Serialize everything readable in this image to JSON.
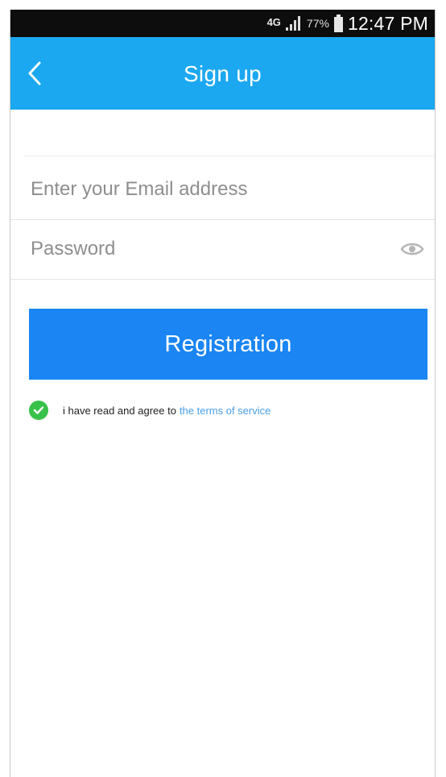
{
  "status_bar": {
    "network": "4G",
    "battery_percent": "77%",
    "time": "12:47 PM"
  },
  "app_bar": {
    "title": "Sign up",
    "back_icon": "chevron-left-icon",
    "background_color": "#1ba8f0"
  },
  "form": {
    "email_placeholder": "Enter your Email address",
    "email_value": "",
    "password_placeholder": "Password",
    "password_value": "",
    "password_toggle_icon": "eye-icon"
  },
  "registration_button": {
    "label": "Registration",
    "color": "#1a85f3"
  },
  "agreement": {
    "checked": true,
    "check_color": "#38c24a",
    "text": "i have read and agree to",
    "link_text": "the terms of service",
    "link_color": "#4aa0e6"
  }
}
